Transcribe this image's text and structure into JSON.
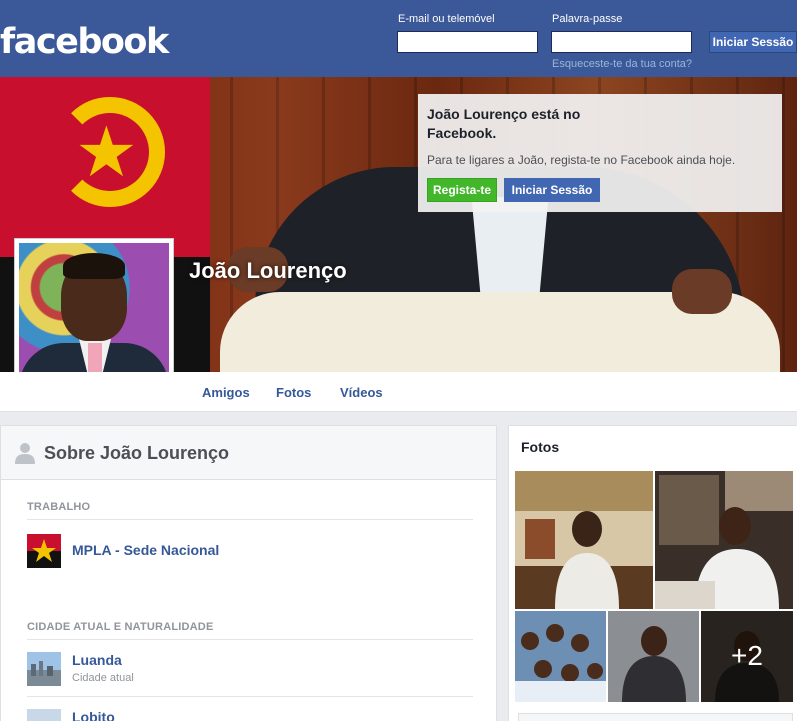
{
  "header": {
    "logo": "facebook",
    "email_label": "E-mail ou telemóvel",
    "password_label": "Palavra-passe",
    "email_value": "",
    "password_value": "",
    "login_button": "Iniciar Sessão",
    "forgot_link": "Esqueceste-te da tua conta?"
  },
  "cover": {
    "name": "João Lourenço",
    "cta_title": "João Lourenço está no Facebook.",
    "cta_text": "Para te ligares a João, regista-te no Facebook ainda hoje.",
    "signup_button": "Regista-te",
    "login_button": "Iniciar Sessão"
  },
  "nav": {
    "items": [
      "Amigos",
      "Fotos",
      "Vídeos"
    ]
  },
  "about": {
    "title": "Sobre João Lourenço",
    "work_label": "TRABALHO",
    "work_entry": "MPLA - Sede Nacional",
    "city_label": "CIDADE ATUAL E NATURALIDADE",
    "cities": [
      {
        "name": "Luanda",
        "sub": "Cidade atual"
      },
      {
        "name": "Lobito",
        "sub": ""
      }
    ]
  },
  "photos": {
    "title": "Fotos",
    "more_count": "+2"
  },
  "colors": {
    "brand": "#3b5998",
    "link": "#365899",
    "signup_green": "#42b72a",
    "button_blue": "#4267b2"
  }
}
